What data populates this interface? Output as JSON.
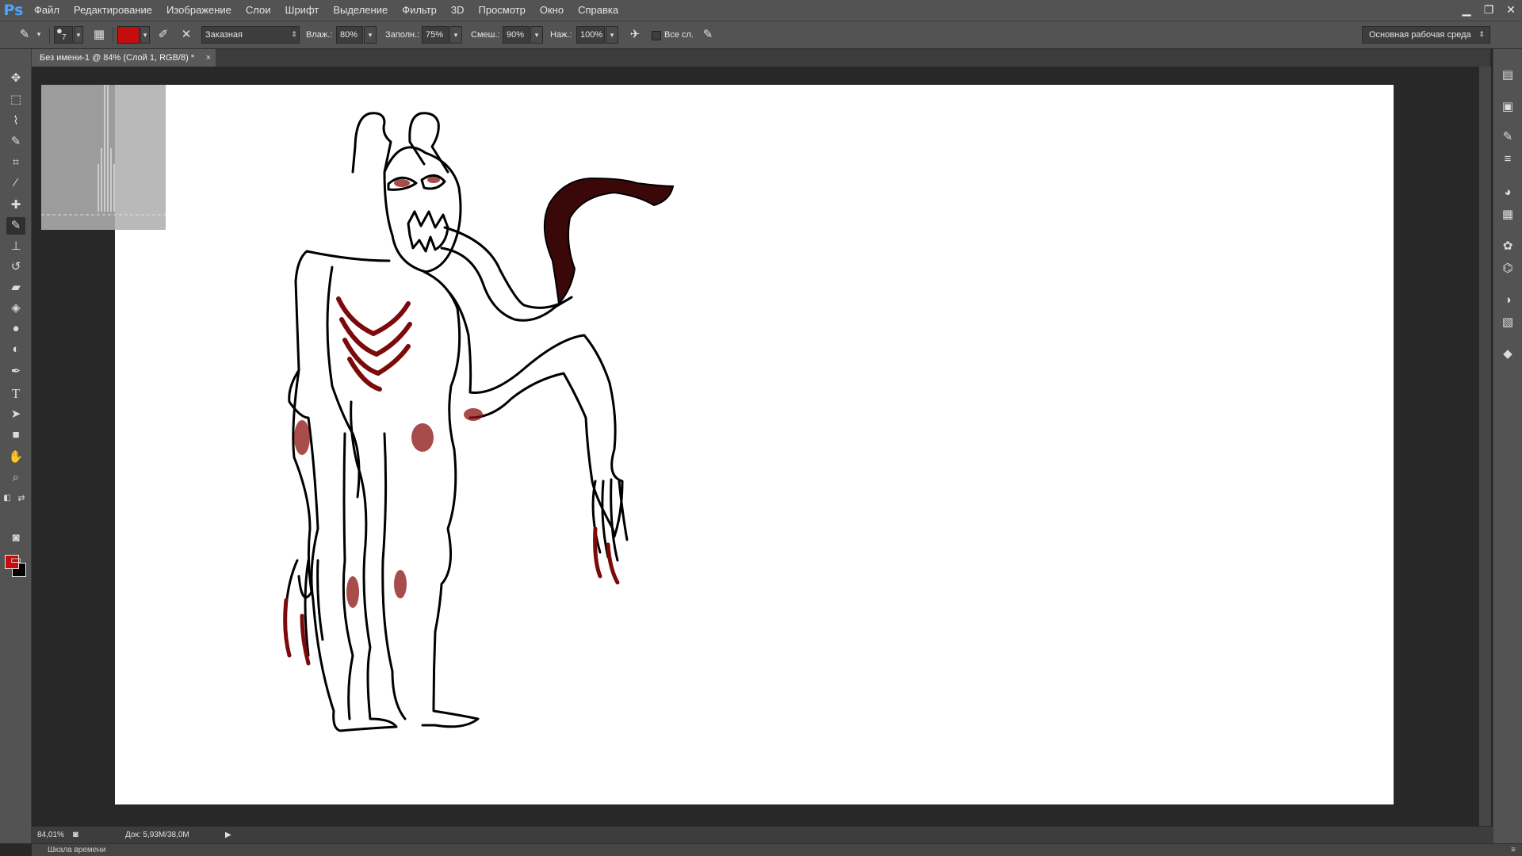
{
  "app": {
    "logo": "Ps"
  },
  "menu": [
    "Файл",
    "Редактирование",
    "Изображение",
    "Слои",
    "Шрифт",
    "Выделение",
    "Фильтр",
    "3D",
    "Просмотр",
    "Окно",
    "Справка"
  ],
  "options": {
    "brush_size": "7",
    "mode": "Заказная",
    "wetness_label": "Влаж.:",
    "wetness_value": "80%",
    "load_label": "Заполн.:",
    "load_value": "75%",
    "mix_label": "Смеш.:",
    "mix_value": "90%",
    "flow_label": "Наж.:",
    "flow_value": "100%",
    "sample_all_label": "Все сл.",
    "workspace": "Основная рабочая среда"
  },
  "document": {
    "tab_title": "Без имени-1 @ 84% (Слой 1, RGB/8) *",
    "tab_close": "×"
  },
  "status": {
    "zoom": "84,01%",
    "doc_size": "Док: 5,93М/38,0М"
  },
  "timeline": {
    "label": "Шкала времени"
  },
  "colors": {
    "foreground": "#c40d0d",
    "background": "#000000",
    "app_accent": "#4da3ff"
  }
}
